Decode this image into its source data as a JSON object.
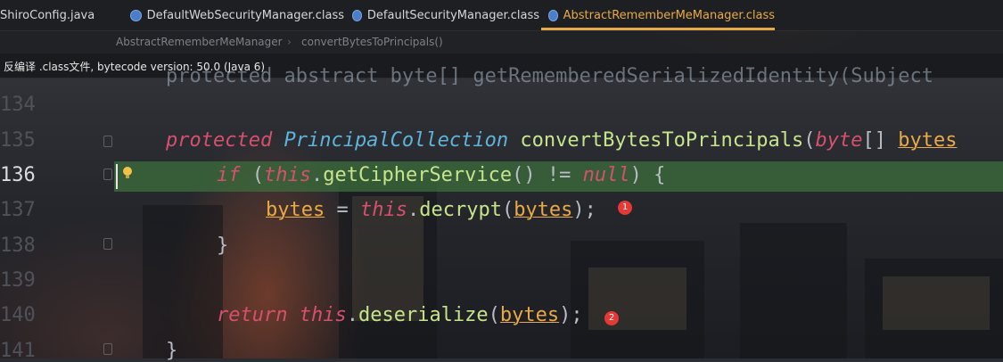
{
  "tabs": [
    {
      "label": "ShiroConfig.java",
      "icon": "java-class-icon",
      "active": false
    },
    {
      "label": "DefaultWebSecurityManager.class",
      "icon": "compiled-class-icon",
      "active": false
    },
    {
      "label": "DefaultSecurityManager.class",
      "icon": "compiled-class-icon",
      "active": false
    },
    {
      "label": "AbstractRememberMeManager.class",
      "icon": "compiled-class-icon",
      "active": true
    }
  ],
  "close_glyph": "×",
  "breadcrumb": {
    "class_name": "AbstractRememberMeManager",
    "separator": "›",
    "method_name": "convertBytesToPrincipals()"
  },
  "banner": {
    "text": "反编译 .class文件, bytecode version: 50.0 (Java 6)"
  },
  "line_numbers": [
    "134",
    "135",
    "136",
    "137",
    "138",
    "139",
    "140",
    "141"
  ],
  "current_line": "136",
  "code": {
    "line0_partial": "protected abstract byte[] getRememberedSerializedIdentity(Subject",
    "l135": {
      "kw": "protected",
      "type": "PrincipalCollection",
      "fn": "convertBytesToPrincipals",
      "open": "(",
      "ptype": "byte",
      "brk": "[] ",
      "param": "bytes"
    },
    "l136": {
      "kw": "if",
      "open": " (",
      "this": "this",
      "dot": ".",
      "fn": "getCipherService",
      "call": "() != ",
      "nul": "null",
      "close": ") {"
    },
    "l137": {
      "var": "bytes",
      "eq": " = ",
      "this": "this",
      "dot": ".",
      "fn": "decrypt",
      "open": "(",
      "arg": "bytes",
      "close": ");"
    },
    "l138": {
      "brace": "}"
    },
    "l140": {
      "kw": "return",
      "sp": " ",
      "this": "this",
      "dot": ".",
      "fn": "deserialize",
      "open": "(",
      "arg": "bytes",
      "close": ");"
    },
    "l141": {
      "brace": "}"
    }
  },
  "badges": [
    "1",
    "2"
  ],
  "colors": {
    "keyword": "#d6506e",
    "type": "#5fb3d9",
    "method": "#c6e48b",
    "parameter": "#e8a947",
    "active_tab": "#e8a947",
    "current_line_bg": "#3c6e3c",
    "badge": "#e53935"
  }
}
